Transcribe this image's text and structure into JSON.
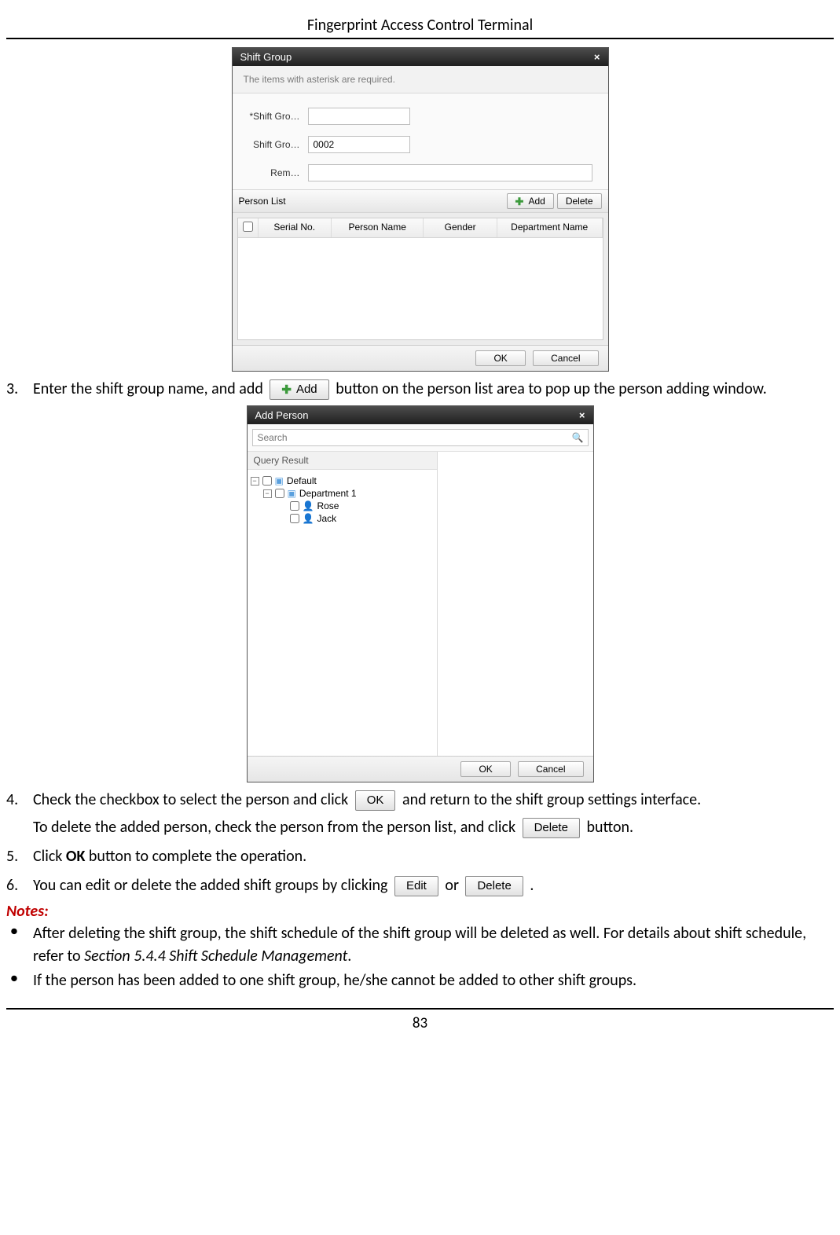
{
  "header": "Fingerprint Access Control Terminal",
  "page_number": "83",
  "shift_dialog": {
    "title": "Shift Group",
    "close_glyph": "×",
    "info": "The items with asterisk are required.",
    "fields": {
      "name_label": "*Shift Gro…",
      "name_value": "",
      "code_label": "Shift Gro…",
      "code_value": "0002",
      "remark_label": "Rem…",
      "remark_value": ""
    },
    "person_list_label": "Person List",
    "add_btn": "Add",
    "delete_btn": "Delete",
    "columns": {
      "serial": "Serial No.",
      "name": "Person Name",
      "gender": "Gender",
      "dept": "Department Name"
    },
    "ok": "OK",
    "cancel": "Cancel"
  },
  "add_person_dialog": {
    "title": "Add Person",
    "close_glyph": "×",
    "search_placeholder": "Search",
    "query_result": "Query Result",
    "tree": {
      "root": "Default",
      "dept": "Department 1",
      "p1": "Rose",
      "p2": "Jack"
    },
    "ok": "OK",
    "cancel": "Cancel"
  },
  "body": {
    "step3_num": "3.",
    "step3a": "Enter the shift group name, and add",
    "step3_btn": "Add",
    "step3b": "button on the person list area to pop up the person adding window.",
    "step4_num": "4.",
    "step4a": "Check the checkbox to select the person and click",
    "step4_ok_btn": "OK",
    "step4b": "and return to the shift group settings interface.",
    "step4c": "To delete the added person, check the person from the person list, and click",
    "step4_del_btn": "Delete",
    "step4d": "button.",
    "step5_num": "5.",
    "step5a": "Click ",
    "step5_bold": "OK",
    "step5b": " button to complete the operation.",
    "step6_num": "6.",
    "step6a": "You can edit or delete the added shift groups by clicking",
    "step6_edit_btn": "Edit",
    "step6b": "or",
    "step6_del_btn": "Delete",
    "step6c": ".",
    "notes_label": "Notes:",
    "note1a": "After deleting the shift group, the shift schedule of the shift group will be deleted as well. For details about shift schedule, refer to ",
    "note1_ref": "Section 5.4.4 Shift Schedule Management",
    "note1b": ".",
    "note2": "If the person has been added to one shift group, he/she cannot be added to other shift groups."
  }
}
